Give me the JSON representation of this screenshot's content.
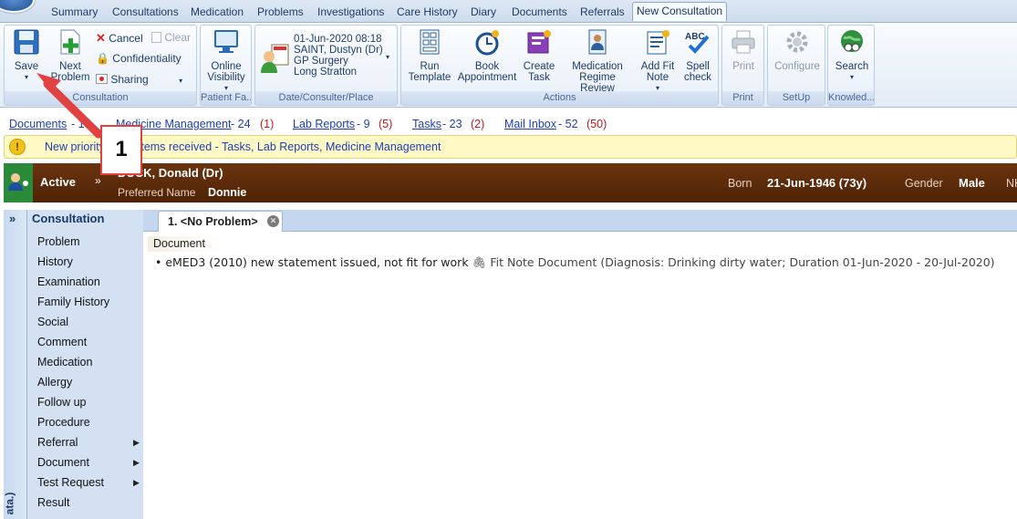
{
  "tabs": [
    "Summary",
    "Consultations",
    "Medication",
    "Problems",
    "Investigations",
    "Care History",
    "Diary",
    "Documents",
    "Referrals",
    "New Consultation"
  ],
  "active_tab": "New Consultation",
  "ribbon": {
    "consultation": {
      "save": "Save",
      "next_problem": [
        "Next",
        "Problem"
      ],
      "cancel": "Cancel",
      "clear": "Clear",
      "confidentiality": "Confidentiality",
      "sharing": "Sharing",
      "group_label": "Consultation"
    },
    "patient_facing": {
      "online_visibility": [
        "Online",
        "Visibility"
      ],
      "group_label": "Patient Fa..."
    },
    "date_consulter": {
      "date": "01-Jun-2020 08:18",
      "consulter": "SAINT, Dustyn (Dr)",
      "place": "GP Surgery",
      "location": "Long Stratton",
      "group_label": "Date/Consulter/Place"
    },
    "actions": {
      "run_template": [
        "Run",
        "Template"
      ],
      "book_appointment": [
        "Book",
        "Appointment"
      ],
      "create_task": [
        "Create",
        "Task"
      ],
      "medication_review": [
        "Medication",
        "Regime Review"
      ],
      "add_fit_note": [
        "Add Fit",
        "Note"
      ],
      "spell_check": [
        "Spell",
        "check"
      ],
      "group_label": "Actions"
    },
    "print": {
      "label": "Print",
      "group_label": "Print"
    },
    "setup": {
      "label": "Configure",
      "group_label": "SetUp"
    },
    "knowledge": {
      "label": "Search",
      "group_label": "Knowled..."
    }
  },
  "links": {
    "documents": {
      "label": "Documents",
      "count": "- 15"
    },
    "medicine_management": {
      "label": "Medicine Management",
      "count": "- 24",
      "urgent": "(1)"
    },
    "lab_reports": {
      "label": "Lab Reports",
      "count": "- 9",
      "urgent": "(5)"
    },
    "tasks": {
      "label": "Tasks",
      "count": "- 23",
      "urgent": "(2)"
    },
    "mail_inbox": {
      "label": "Mail Inbox",
      "count": "- 52",
      "urgent": "(50)"
    }
  },
  "alert": {
    "text": "New priority Work Items received - Tasks, Lab Reports, Medicine Management"
  },
  "patient": {
    "status": "Active",
    "name": "DUCK, Donald (Dr)",
    "preferred_label": "Preferred Name",
    "preferred_name": "Donnie",
    "born_label": "Born",
    "born": "21-Jun-1946 (73y)",
    "gender_label": "Gender",
    "gender": "Male",
    "nhs_label": "NHS"
  },
  "left_strip": {
    "expand": "»",
    "vertical_text": "ata.)"
  },
  "nav": {
    "title": "Consultation",
    "items": [
      {
        "label": "Problem",
        "submenu": false
      },
      {
        "label": "History",
        "submenu": false
      },
      {
        "label": "Examination",
        "submenu": false
      },
      {
        "label": "Family History",
        "submenu": false
      },
      {
        "label": "Social",
        "submenu": false
      },
      {
        "label": "Comment",
        "submenu": false
      },
      {
        "label": "Medication",
        "submenu": false
      },
      {
        "label": "Allergy",
        "submenu": false
      },
      {
        "label": "Follow up",
        "submenu": false
      },
      {
        "label": "Procedure",
        "submenu": false
      },
      {
        "label": "Referral",
        "submenu": true
      },
      {
        "label": "Document",
        "submenu": true
      },
      {
        "label": "Test Request",
        "submenu": true
      },
      {
        "label": "Result",
        "submenu": false
      }
    ]
  },
  "consult_tab": {
    "label": "1. <No Problem>"
  },
  "content": {
    "section_header": "Document",
    "entry_text": "eMED3 (2010) new statement issued, not fit for work",
    "entry_detail": "Fit Note Document (Diagnosis: Drinking dirty water; Duration 01-Jun-2020 - 20-Jul-2020)"
  },
  "callout": {
    "number": "1"
  },
  "colors": {
    "accent": "#1e3c68",
    "patient_bar": "#5a2b08",
    "alert_bg": "#fff9c6",
    "callout_border": "#e04141",
    "urgent": "#c01818"
  }
}
